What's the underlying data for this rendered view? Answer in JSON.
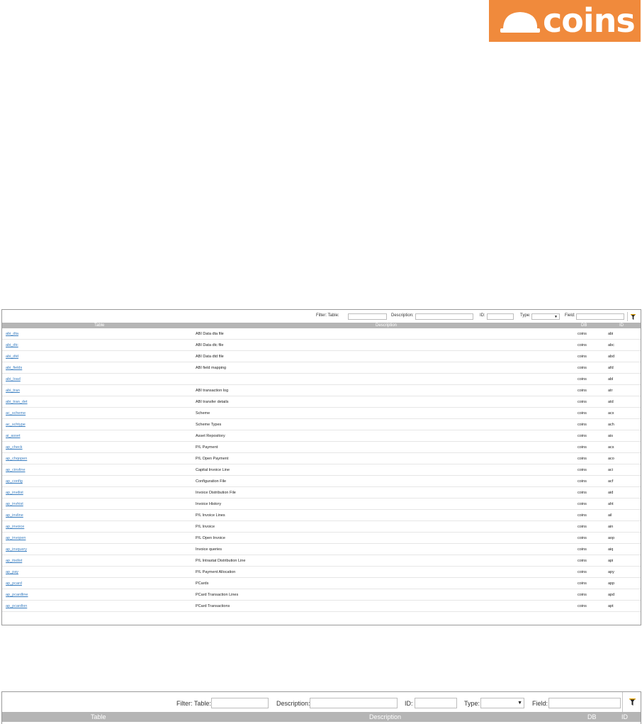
{
  "logo": {
    "text": "coins",
    "color": "#f08a3c"
  },
  "filter": {
    "table_label": "Filter: Table:",
    "description_label": "Description:",
    "id_label": "ID:",
    "type_label": "Type:",
    "field_label": "Field:",
    "type_value": "",
    "funnel_icon": "filter-icon"
  },
  "columns": {
    "table": "Table",
    "description": "Description",
    "db": "DB",
    "id": "ID"
  },
  "rows": [
    {
      "table": "abi_dta",
      "description": "ABI Data dta file",
      "db": "coins",
      "id": "abi"
    },
    {
      "table": "abi_dtc",
      "description": "ABI Data dtc file",
      "db": "coins",
      "id": "abc"
    },
    {
      "table": "abi_dtd",
      "description": "ABI Data dtd file",
      "db": "coins",
      "id": "abd"
    },
    {
      "table": "abi_fields",
      "description": "ABI field mapping",
      "db": "coins",
      "id": "afd"
    },
    {
      "table": "abi_load",
      "description": "",
      "db": "coins",
      "id": "abl"
    },
    {
      "table": "abi_tran",
      "description": "ABI transaction log",
      "db": "coins",
      "id": "atr"
    },
    {
      "table": "abi_tran_det",
      "description": "ABI transfer details",
      "db": "coins",
      "id": "atd"
    },
    {
      "table": "ac_scheme",
      "description": "Scheme",
      "db": "coins",
      "id": "acx"
    },
    {
      "table": "ac_schtype",
      "description": "Scheme Types",
      "db": "coins",
      "id": "ach"
    },
    {
      "table": "ai_asset",
      "description": "Asset Repository",
      "db": "coins",
      "id": "ais"
    },
    {
      "table": "ap_check",
      "description": "P/L Payment",
      "db": "coins",
      "id": "acs"
    },
    {
      "table": "ap_chqopen",
      "description": "P/L Open Payment",
      "db": "coins",
      "id": "aco"
    },
    {
      "table": "ap_cinvline",
      "description": "Capital Invoice Line",
      "db": "coins",
      "id": "aci"
    },
    {
      "table": "ap_config",
      "description": "Configuration File",
      "db": "coins",
      "id": "acf"
    },
    {
      "table": "ap_invdist",
      "description": "Invoice Distribution File",
      "db": "coins",
      "id": "aid"
    },
    {
      "table": "ap_invhist",
      "description": "Invoice History",
      "db": "coins",
      "id": "aht"
    },
    {
      "table": "ap_invline",
      "description": "P/L Invoice Lines",
      "db": "coins",
      "id": "ail"
    },
    {
      "table": "ap_invoice",
      "description": "P/L Invoice",
      "db": "coins",
      "id": "ain"
    },
    {
      "table": "ap_invopen",
      "description": "P/L Open Invoice",
      "db": "coins",
      "id": "aop"
    },
    {
      "table": "ap_invquery",
      "description": "Invoice queries",
      "db": "coins",
      "id": "aiq"
    },
    {
      "table": "ap_itsdist",
      "description": "P/L Intrastat Distribution Line",
      "db": "coins",
      "id": "api"
    },
    {
      "table": "ap_pay",
      "description": "P/L Payment Allocation",
      "db": "coins",
      "id": "apy"
    },
    {
      "table": "ap_pcard",
      "description": "PCards",
      "db": "coins",
      "id": "app"
    },
    {
      "table": "ap_pcardline",
      "description": "PCard Transaction Lines",
      "db": "coins",
      "id": "apd"
    },
    {
      "table": "ap_pcardtxn",
      "description": "PCard Transactions",
      "db": "coins",
      "id": "apt"
    }
  ]
}
